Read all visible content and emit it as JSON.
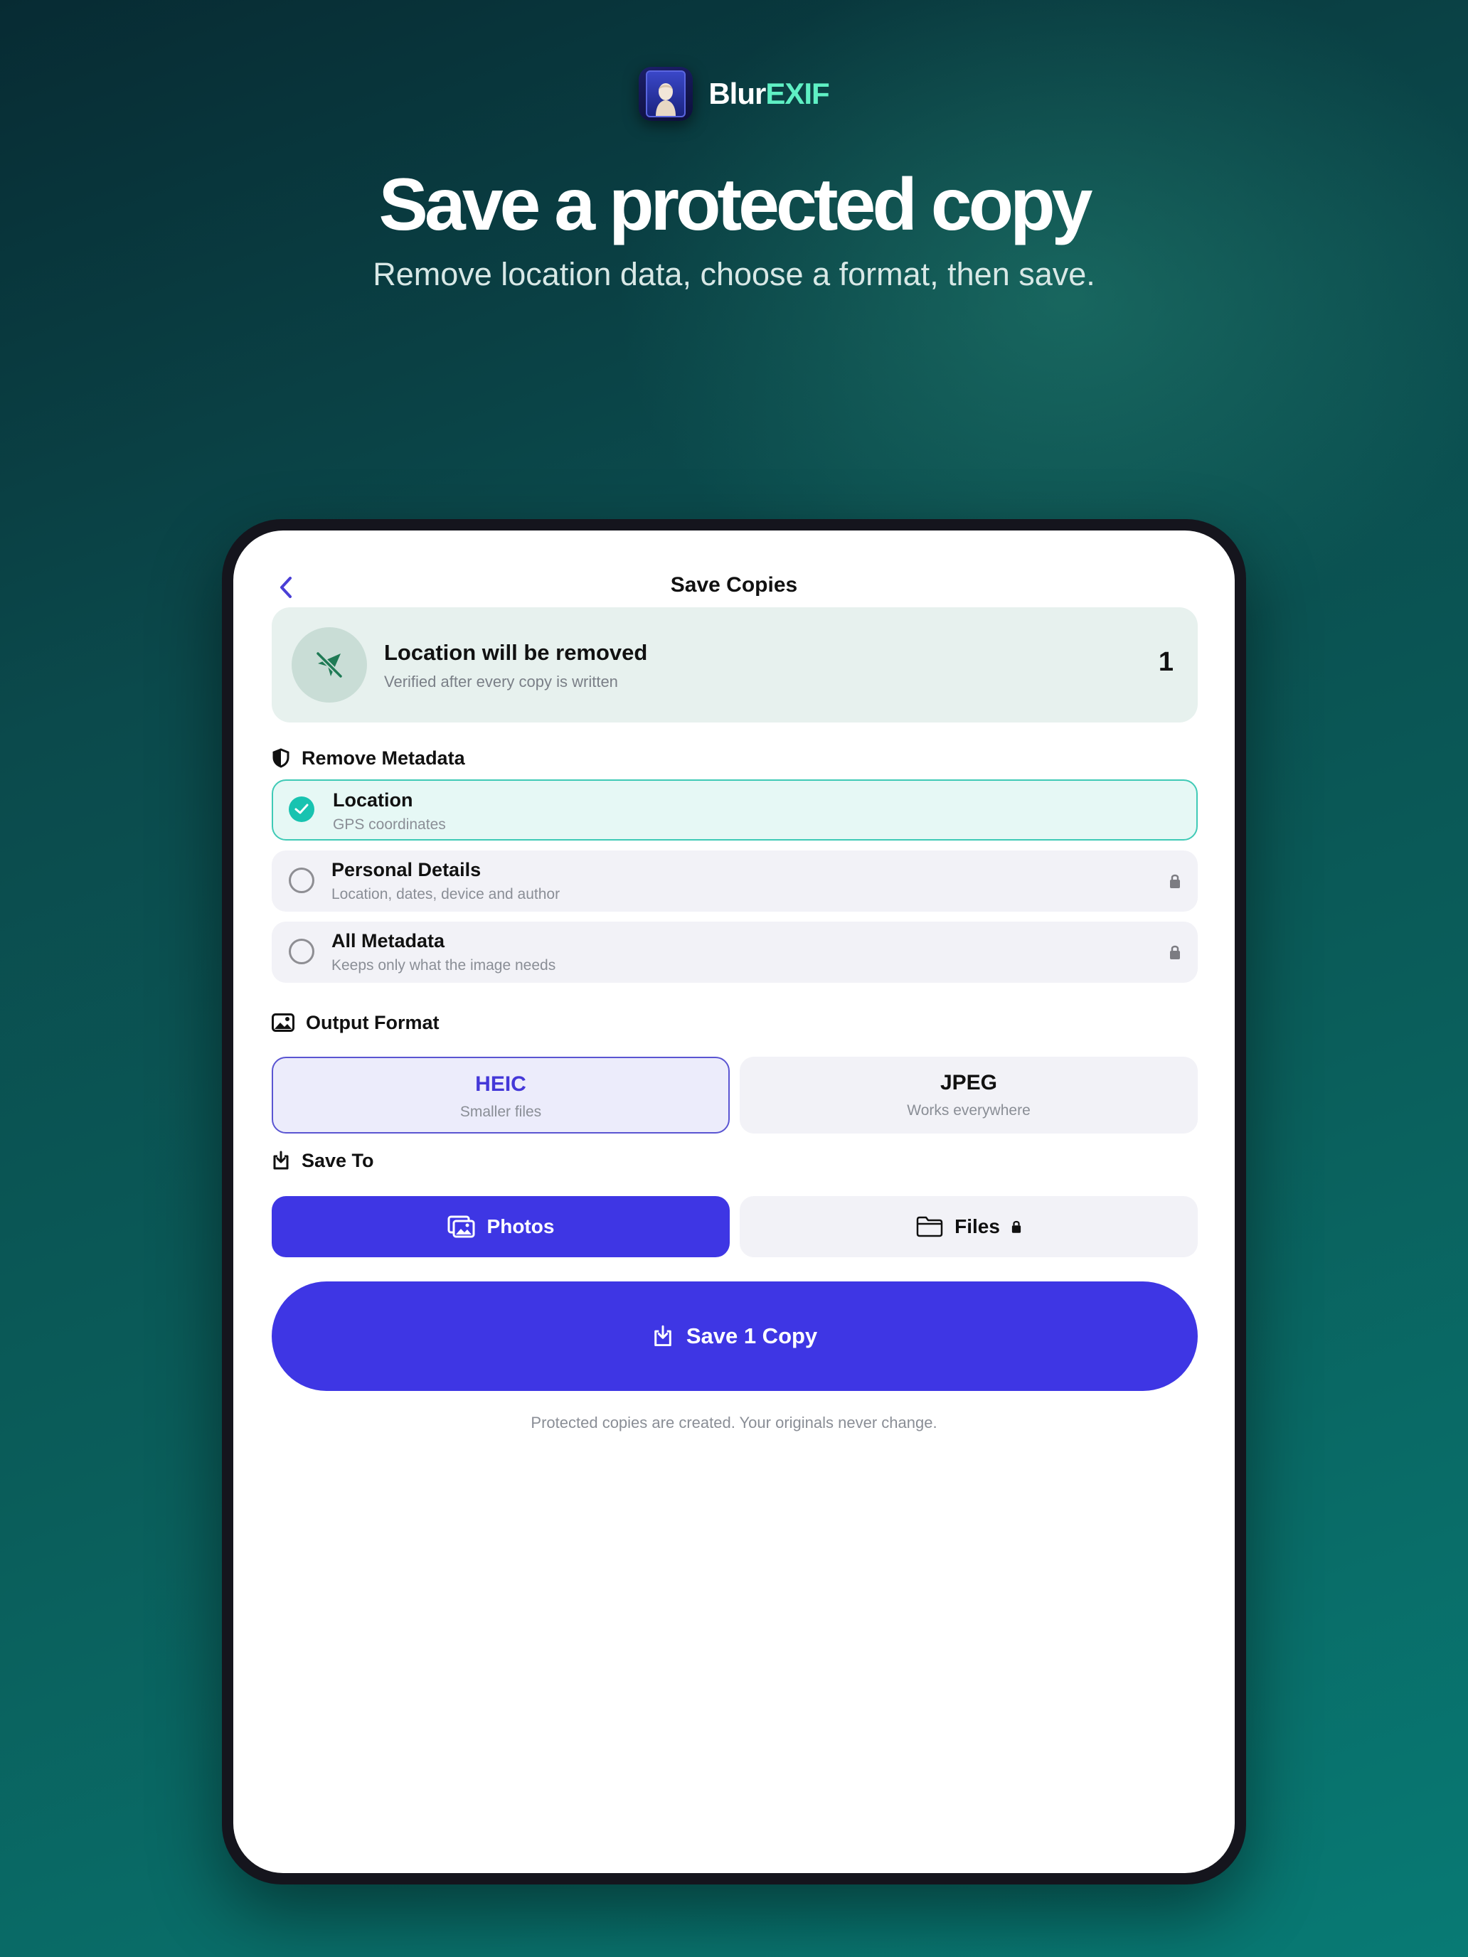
{
  "brand": {
    "name_part1": "Blur",
    "name_part2": "EXIF",
    "icon": "app-icon-portrait"
  },
  "headline": "Save a protected copy",
  "subheadline": "Remove location data, choose a format, then save.",
  "screen": {
    "nav": {
      "back_icon": "chevron-left-icon",
      "title": "Save Copies"
    },
    "banner": {
      "icon": "location-off-icon",
      "title": "Location will be removed",
      "subtitle": "Verified after every copy is written",
      "count": "1"
    },
    "metadata_section": {
      "heading": "Remove Metadata",
      "icon": "shield-icon",
      "options": [
        {
          "title": "Location",
          "subtitle": "GPS coordinates",
          "selected": true,
          "locked": false
        },
        {
          "title": "Personal Details",
          "subtitle": "Location, dates, device and author",
          "selected": false,
          "locked": true
        },
        {
          "title": "All Metadata",
          "subtitle": "Keeps only what the image needs",
          "selected": false,
          "locked": true
        }
      ]
    },
    "format_section": {
      "heading": "Output Format",
      "icon": "photo-icon",
      "options": [
        {
          "title": "HEIC",
          "subtitle": "Smaller files",
          "selected": true
        },
        {
          "title": "JPEG",
          "subtitle": "Works everywhere",
          "selected": false
        }
      ]
    },
    "save_to_section": {
      "heading": "Save To",
      "icon": "save-tray-icon",
      "options": [
        {
          "label": "Photos",
          "icon": "photos-stack-icon",
          "selected": true,
          "locked": false
        },
        {
          "label": "Files",
          "icon": "folder-icon",
          "selected": false,
          "locked": true
        }
      ]
    },
    "save_button": {
      "label": "Save 1 Copy",
      "icon": "save-tray-icon"
    },
    "footnote": "Protected copies are created. Your originals never change.",
    "colors": {
      "accent": "#3e36e4",
      "teal": "#18c3b0",
      "banner_bg": "#e7f1ee"
    }
  }
}
